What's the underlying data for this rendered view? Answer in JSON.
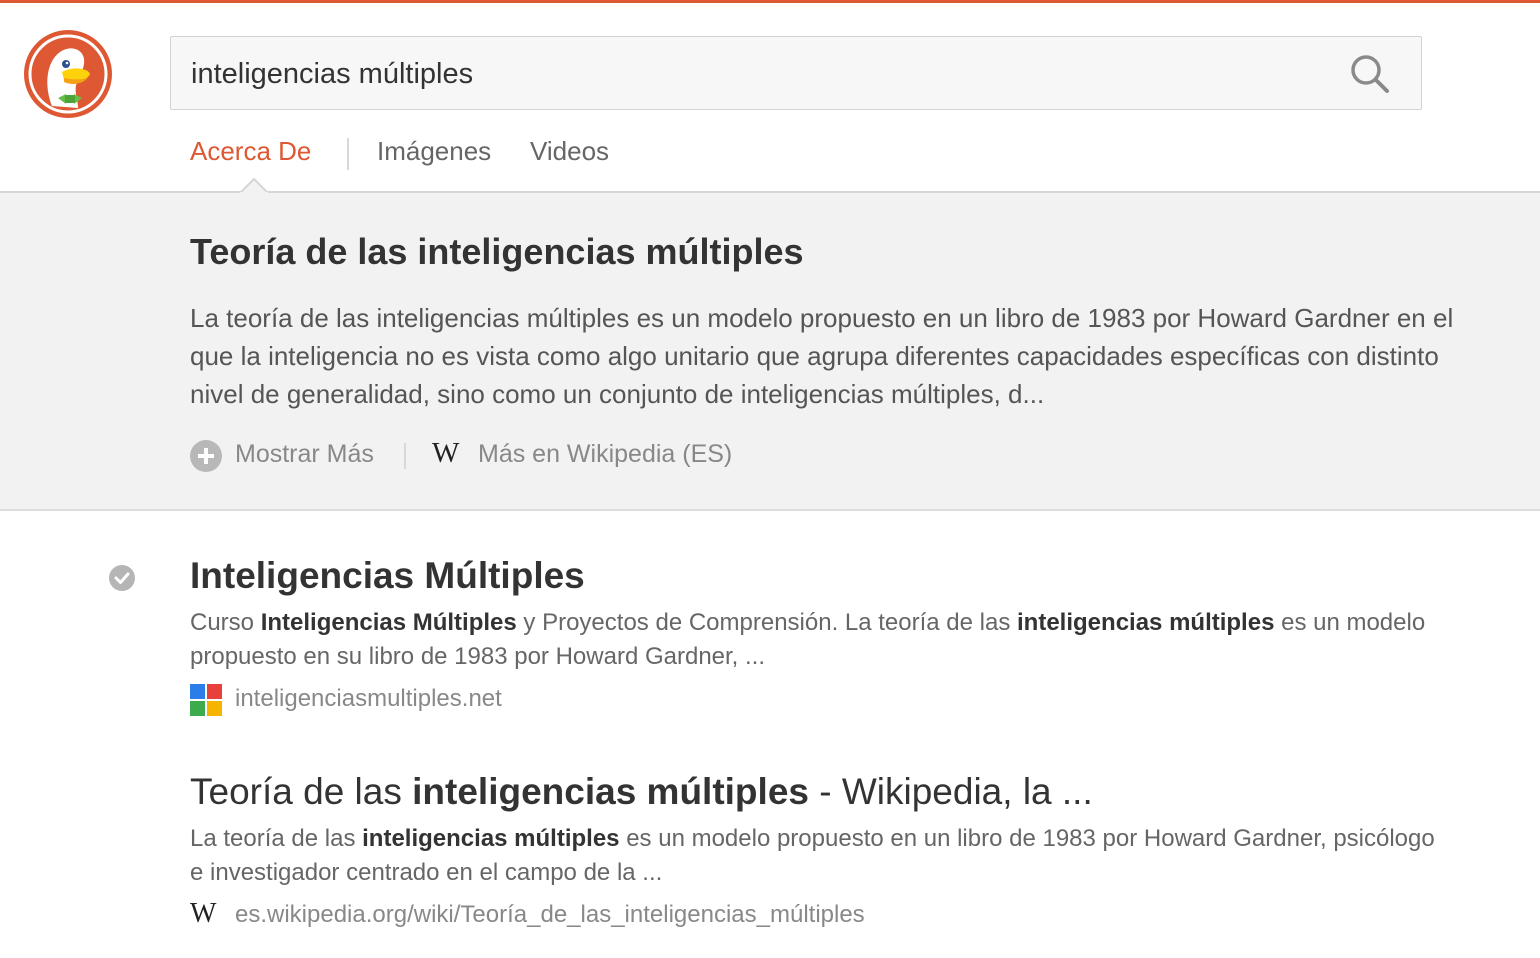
{
  "search": {
    "query": "inteligencias múltiples"
  },
  "tabs": [
    {
      "label": "Acerca De",
      "active": true
    },
    {
      "label": "Imágenes",
      "active": false
    },
    {
      "label": "Videos",
      "active": false
    }
  ],
  "about": {
    "title": "Teoría de las inteligencias múltiples",
    "description": "La teoría de las inteligencias múltiples es un modelo propuesto en un libro de 1983 por Howard Gardner en el que la inteligencia no es vista como algo unitario que agrupa diferentes capacidades específicas con distinto nivel de generalidad, sino como un conjunto de inteligencias múltiples, d...",
    "more_label": "Mostrar Más",
    "wiki_label": "Más en Wikipedia (ES)"
  },
  "results": [
    {
      "title": [
        {
          "t": "Inteligencias Múltiples",
          "b": true
        }
      ],
      "snippet": [
        {
          "t": "Curso ",
          "b": false
        },
        {
          "t": "Inteligencias Múltiples",
          "b": true
        },
        {
          "t": " y Proyectos de Comprensión. La teoría de las ",
          "b": false
        },
        {
          "t": "inteligencias múltiples",
          "b": true
        },
        {
          "t": " es un modelo propuesto en su libro de 1983 por Howard Gardner, ...",
          "b": false
        }
      ],
      "url": "inteligenciasmultiples.net",
      "favicon": "colored-squares-icon",
      "verified": true
    },
    {
      "title": [
        {
          "t": "Teoría de las ",
          "b": false
        },
        {
          "t": "inteligencias múltiples",
          "b": true
        },
        {
          "t": " - Wikipedia, la ...",
          "b": false
        }
      ],
      "snippet": [
        {
          "t": "La teoría de las ",
          "b": false
        },
        {
          "t": "inteligencias múltiples",
          "b": true
        },
        {
          "t": " es un modelo propuesto en un libro de 1983 por Howard Gardner, psicólogo e investigador centrado en el campo de la ...",
          "b": false
        }
      ],
      "url": "es.wikipedia.org/wiki/Teoría_de_las_inteligencias_múltiples",
      "favicon": "wikipedia-icon",
      "verified": false
    }
  ],
  "colors": {
    "accent": "#de5833",
    "about_bg": "#f2f2f2",
    "text": "#333333",
    "muted": "#888888"
  }
}
